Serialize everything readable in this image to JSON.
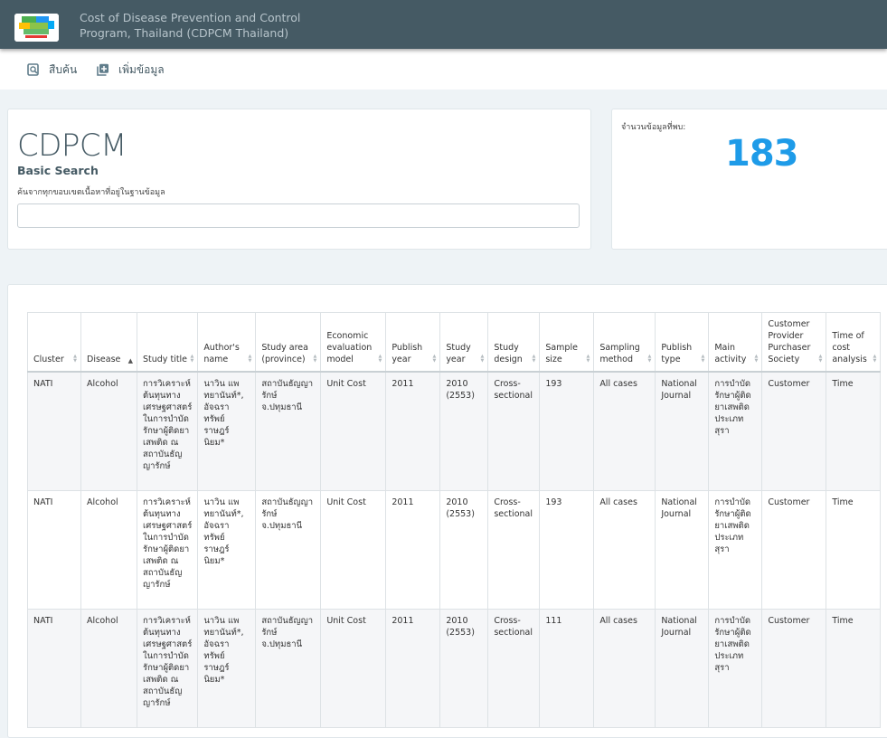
{
  "header": {
    "title_line1": "Cost of Disease Prevention and Control",
    "title_line2": "Program, Thailand (CDPCM Thailand)"
  },
  "nav": {
    "items": [
      {
        "label": "สืบค้น",
        "icon": "search-doc-icon"
      },
      {
        "label": "เพิ่มข้อมูล",
        "icon": "add-doc-icon"
      }
    ]
  },
  "search": {
    "brand": "CDPCM",
    "subtitle": "Basic Search",
    "help": "ค้นจากทุกขอบเขตเนื้อหาที่อยู่ในฐานข้อมูล",
    "value": "",
    "placeholder": ""
  },
  "count": {
    "label": "จำนวนข้อมูลที่พบ:",
    "value": "183"
  },
  "table": {
    "columns": [
      "Cluster",
      "Disease",
      "Study title",
      "Author's name",
      "Study area (province)",
      "Economic evaluation model",
      "Publish year",
      "Study year",
      "Study design",
      "Sample size",
      "Sampling method",
      "Publish type",
      "Main activity",
      "Customer Provider Purchaser Society",
      "Time of cost analysis"
    ],
    "rows": [
      [
        "NATI",
        "Alcohol",
        "การวิเคราะห์ต้นทุนทางเศรษฐศาสตร์ในการบำบัดรักษาผู้ติดยาเสพติด ณ สถาบันธัญญารักษ์",
        "นาวิน แพทยานันท์*, อัจฉรา ทรัพย์ราษฎร์นิยม*",
        "สถาบันธัญญารักษ์ จ.ปทุมธานี",
        "Unit Cost",
        "2011",
        "2010 (2553)",
        "Cross-sectional",
        "193",
        "All cases",
        "National Journal",
        "การบำบัดรักษาผู้ติดยาเสพติดประเภทสุรา",
        "Customer",
        "Time"
      ],
      [
        "NATI",
        "Alcohol",
        "การวิเคราะห์ต้นทุนทางเศรษฐศาสตร์ในการบำบัดรักษาผู้ติดยาเสพติด ณ สถาบันธัญญารักษ์",
        "นาวิน แพทยานันท์*, อัจฉรา ทรัพย์ราษฎร์นิยม*",
        "สถาบันธัญญารักษ์ จ.ปทุมธานี",
        "Unit Cost",
        "2011",
        "2010 (2553)",
        "Cross-sectional",
        "193",
        "All cases",
        "National Journal",
        "การบำบัดรักษาผู้ติดยาเสพติดประเภทสุรา",
        "Customer",
        "Time"
      ],
      [
        "NATI",
        "Alcohol",
        "การวิเคราะห์ต้นทุนทางเศรษฐศาสตร์ในการบำบัดรักษาผู้ติดยาเสพติด ณ สถาบันธัญญารักษ์",
        "นาวิน แพทยานันท์*, อัจฉรา ทรัพย์ราษฎร์นิยม*",
        "สถาบันธัญญารักษ์ จ.ปทุมธานี",
        "Unit Cost",
        "2011",
        "2010 (2553)",
        "Cross-sectional",
        "111",
        "All cases",
        "National Journal",
        "การบำบัดรักษาผู้ติดยาเสพติดประเภทสุรา",
        "Customer",
        "Time"
      ]
    ],
    "sorted_column": "Disease"
  },
  "colors": {
    "topbar": "#455a64",
    "accent": "#1e9be8"
  }
}
